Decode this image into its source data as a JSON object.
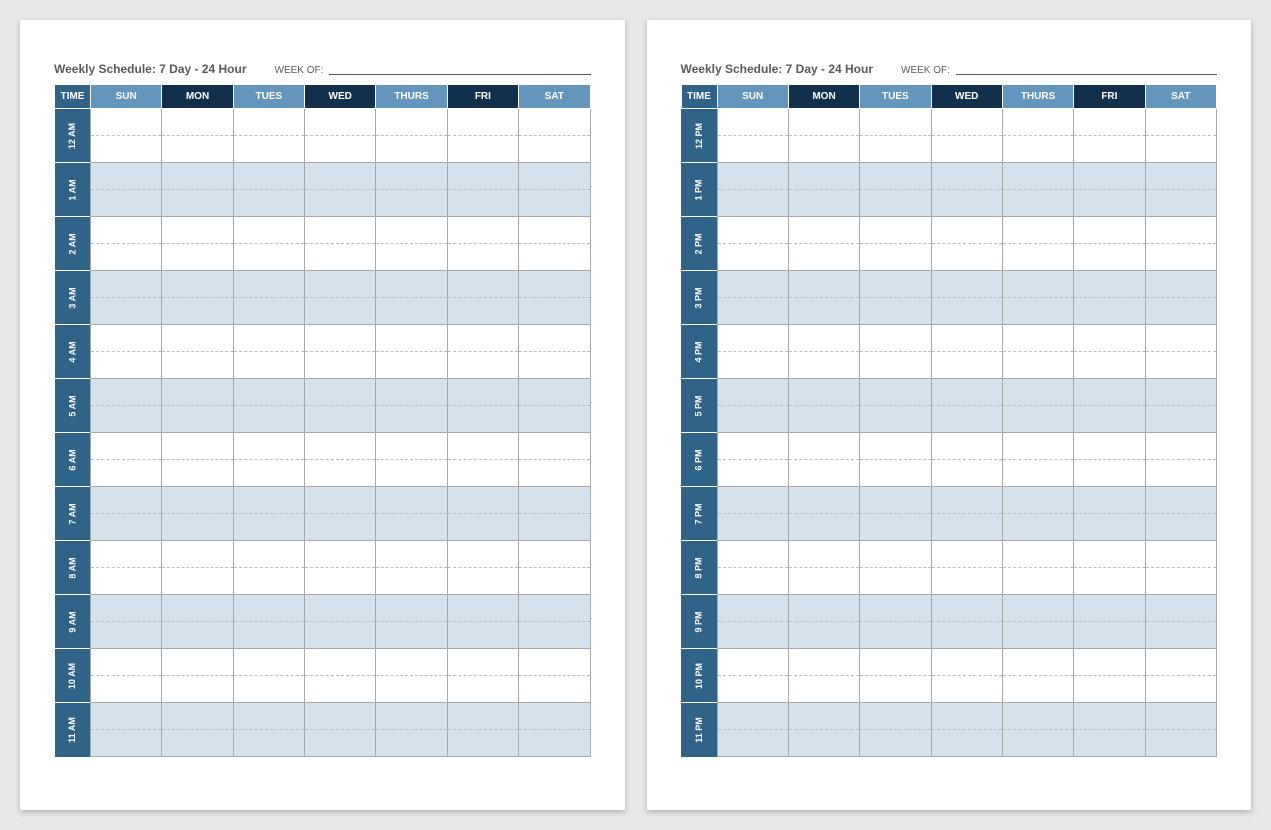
{
  "title": "Weekly Schedule: 7 Day - 24 Hour",
  "week_of_label": "WEEK OF:",
  "headers": {
    "time": "TIME",
    "days": [
      "SUN",
      "MON",
      "TUES",
      "WED",
      "THURS",
      "FRI",
      "SAT"
    ]
  },
  "header_colors": [
    "#6495bd",
    "#12304b",
    "#6495bd",
    "#12304b",
    "#6495bd",
    "#12304b",
    "#6495bd"
  ],
  "pages": [
    {
      "hours": [
        "12 AM",
        "1 AM",
        "2 AM",
        "3 AM",
        "4 AM",
        "5 AM",
        "6 AM",
        "7 AM",
        "8 AM",
        "9 AM",
        "10 AM",
        "11 AM"
      ]
    },
    {
      "hours": [
        "12 PM",
        "1 PM",
        "2 PM",
        "3 PM",
        "4 PM",
        "5 PM",
        "6 PM",
        "7 PM",
        "8 PM",
        "9 PM",
        "10 PM",
        "11 PM"
      ]
    }
  ]
}
